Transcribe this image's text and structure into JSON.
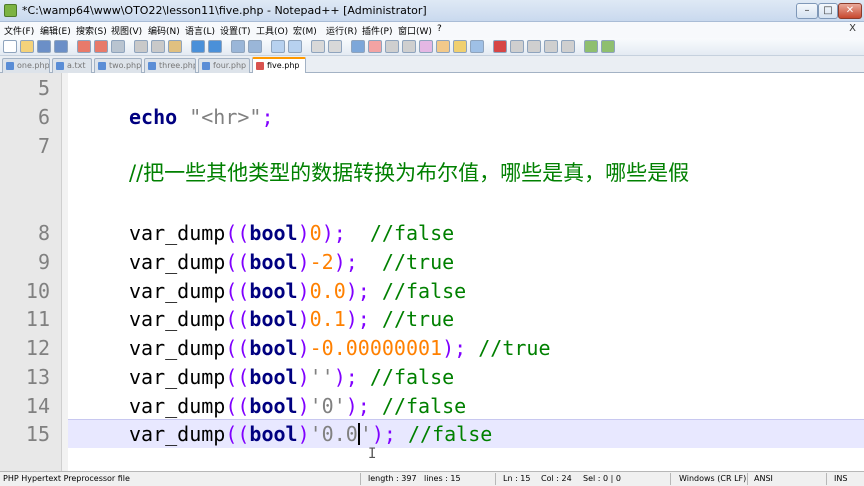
{
  "window": {
    "title": "*C:\\wamp64\\www\\OTO22\\lesson11\\five.php - Notepad++ [Administrator]",
    "minimize": "–",
    "maximize": "□",
    "close": "✕"
  },
  "menu": [
    "文件(F)",
    "编辑(E)",
    "搜索(S)",
    "视图(V)",
    "编码(N)",
    "语言(L)",
    "设置(T)",
    "工具(O)",
    "宏(M)",
    "运行(R)",
    "插件(P)",
    "窗口(W)",
    "?"
  ],
  "menu_close": "X",
  "toolbar_icons": [
    "new-icon",
    "open-icon",
    "save-icon",
    "save-all-icon",
    "close-icon",
    "close-all-icon",
    "print-icon",
    "cut-icon",
    "copy-icon",
    "paste-icon",
    "undo-icon",
    "redo-icon",
    "find-icon",
    "replace-icon",
    "zoom-in-icon",
    "zoom-out-icon",
    "sync-v-icon",
    "sync-h-icon",
    "wrap-icon",
    "all-chars-icon",
    "indent-guide-icon",
    "udl-icon",
    "doc-map-icon",
    "function-list-icon",
    "folder-icon",
    "monitor-icon",
    "record-icon",
    "stop-icon",
    "play-icon",
    "play-multi-icon",
    "save-macro-icon",
    "spell-icon",
    "check-icon"
  ],
  "tabs": [
    {
      "label": "one.php",
      "active": false
    },
    {
      "label": "a.txt",
      "active": false
    },
    {
      "label": "two.php",
      "active": false
    },
    {
      "label": "three.php",
      "active": false
    },
    {
      "label": "four.php",
      "active": false
    },
    {
      "label": "five.php",
      "active": true
    }
  ],
  "lines": {
    "l5": "5",
    "l6": "6",
    "l7": "7",
    "l8": "8",
    "l9": "9",
    "l10": "10",
    "l11": "11",
    "l12": "12",
    "l13": "13",
    "l14": "14",
    "l15": "15"
  },
  "code": {
    "echo_kw": "echo",
    "echo_str": "\"<hr>\"",
    "echo_end": ";",
    "comment_cn": "//把一些其他类型的数据转换为布尔值，哪些是真，哪些是假",
    "fn": "var_dump",
    "lp": "((",
    "bool": "bool",
    "rp": ")",
    "end": ");",
    "v8": "0",
    "c8": "//false",
    "v9": "-2",
    "c9": "//true",
    "v10": "0.0",
    "c10": "//false",
    "v11": "0.1",
    "c11": "//true",
    "v12": "-0.00000001",
    "c12": "//true",
    "v13": "''",
    "c13": "//false",
    "v14": "'0'",
    "c14": "//false",
    "v15a": "'0.0",
    "v15b": "'",
    "c15": "//false"
  },
  "status": {
    "file_type": "PHP Hypertext Preprocessor file",
    "length": "length : 397",
    "lines": "lines : 15",
    "ln": "Ln : 15",
    "col": "Col : 24",
    "sel": "Sel : 0 | 0",
    "eol": "Windows (CR LF)",
    "encoding": "ANSI",
    "ins": "INS"
  },
  "colors": {
    "keyword": "#000080",
    "number": "#ff8000",
    "string": "#808080",
    "comment": "#008000",
    "operator": "#8000ff",
    "current_line": "#e8e8ff"
  }
}
